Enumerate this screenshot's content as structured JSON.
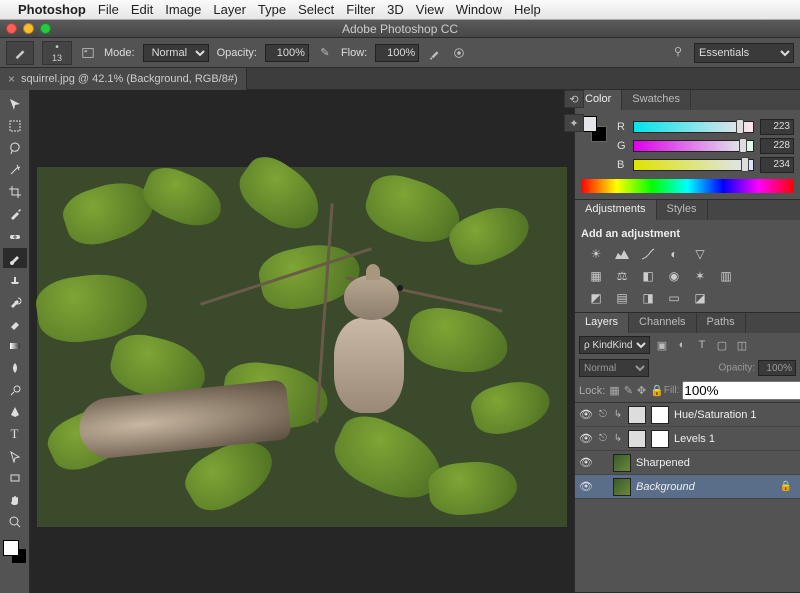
{
  "menubar": {
    "app": "Photoshop",
    "items": [
      "File",
      "Edit",
      "Image",
      "Layer",
      "Type",
      "Select",
      "Filter",
      "3D",
      "View",
      "Window",
      "Help"
    ]
  },
  "window": {
    "title": "Adobe Photoshop CC"
  },
  "options": {
    "brush_size": "13",
    "mode_lbl": "Mode:",
    "mode": "Normal",
    "opacity_lbl": "Opacity:",
    "opacity": "100%",
    "flow_lbl": "Flow:",
    "flow": "100%"
  },
  "doc": {
    "tab": "squirrel.jpg @ 42.1% (Background, RGB/8#)"
  },
  "workspace": {
    "name": "Essentials"
  },
  "color": {
    "tabs": [
      "Color",
      "Swatches"
    ],
    "r": 223,
    "g": 228,
    "b": 234
  },
  "adjustments": {
    "tabs": [
      "Adjustments",
      "Styles"
    ],
    "header": "Add an adjustment"
  },
  "layers": {
    "tabs": [
      "Layers",
      "Channels",
      "Paths"
    ],
    "kind": "Kind",
    "blend": "Normal",
    "opacity_lbl": "Opacity:",
    "opacity": "100%",
    "lock_lbl": "Lock:",
    "fill_lbl": "Fill:",
    "fill": "100%",
    "items": [
      {
        "name": "Hue/Saturation 1",
        "type": "adj"
      },
      {
        "name": "Levels 1",
        "type": "adj"
      },
      {
        "name": "Sharpened",
        "type": "img"
      },
      {
        "name": "Background",
        "type": "img",
        "locked": true,
        "selected": true,
        "italic": true
      }
    ]
  },
  "tools": [
    "move",
    "marquee",
    "lasso",
    "wand",
    "crop",
    "eyedropper",
    "heal",
    "brush",
    "stamp",
    "history",
    "eraser",
    "gradient",
    "blur",
    "dodge",
    "pen",
    "type",
    "path",
    "rect",
    "hand",
    "zoom"
  ]
}
